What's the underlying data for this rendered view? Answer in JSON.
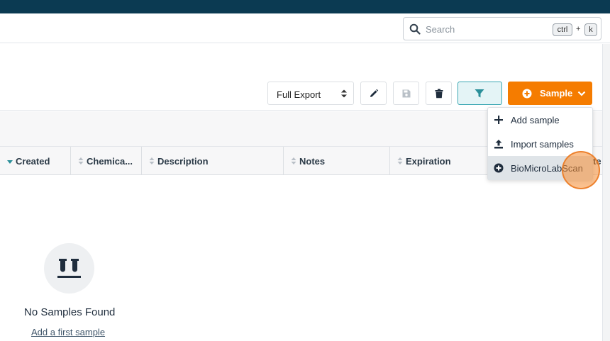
{
  "search": {
    "placeholder": "Search",
    "shortcut_ctrl": "ctrl",
    "shortcut_plus": "+",
    "shortcut_key": "k"
  },
  "toolbar": {
    "export_select": {
      "value": "Full Export"
    },
    "sample_button_label": "Sample"
  },
  "table": {
    "columns": [
      {
        "label": "Created"
      },
      {
        "label": "Chemica..."
      },
      {
        "label": "Description"
      },
      {
        "label": "Notes"
      },
      {
        "label": "Expiration"
      }
    ],
    "hidden_peek": "te"
  },
  "dropdown": {
    "items": [
      {
        "label": "Add sample",
        "icon": "plus-icon"
      },
      {
        "label": "Import samples",
        "icon": "upload-icon"
      },
      {
        "label": "BioMicroLabScan",
        "icon": "plus-circle-icon"
      }
    ]
  },
  "empty_state": {
    "title": "No Samples Found",
    "link": "Add a first sample",
    "icon": "test-tubes-icon"
  },
  "colors": {
    "header": "#0b3a52",
    "accent_orange": "#f57c00",
    "filter_teal": "#3aa7b2"
  }
}
